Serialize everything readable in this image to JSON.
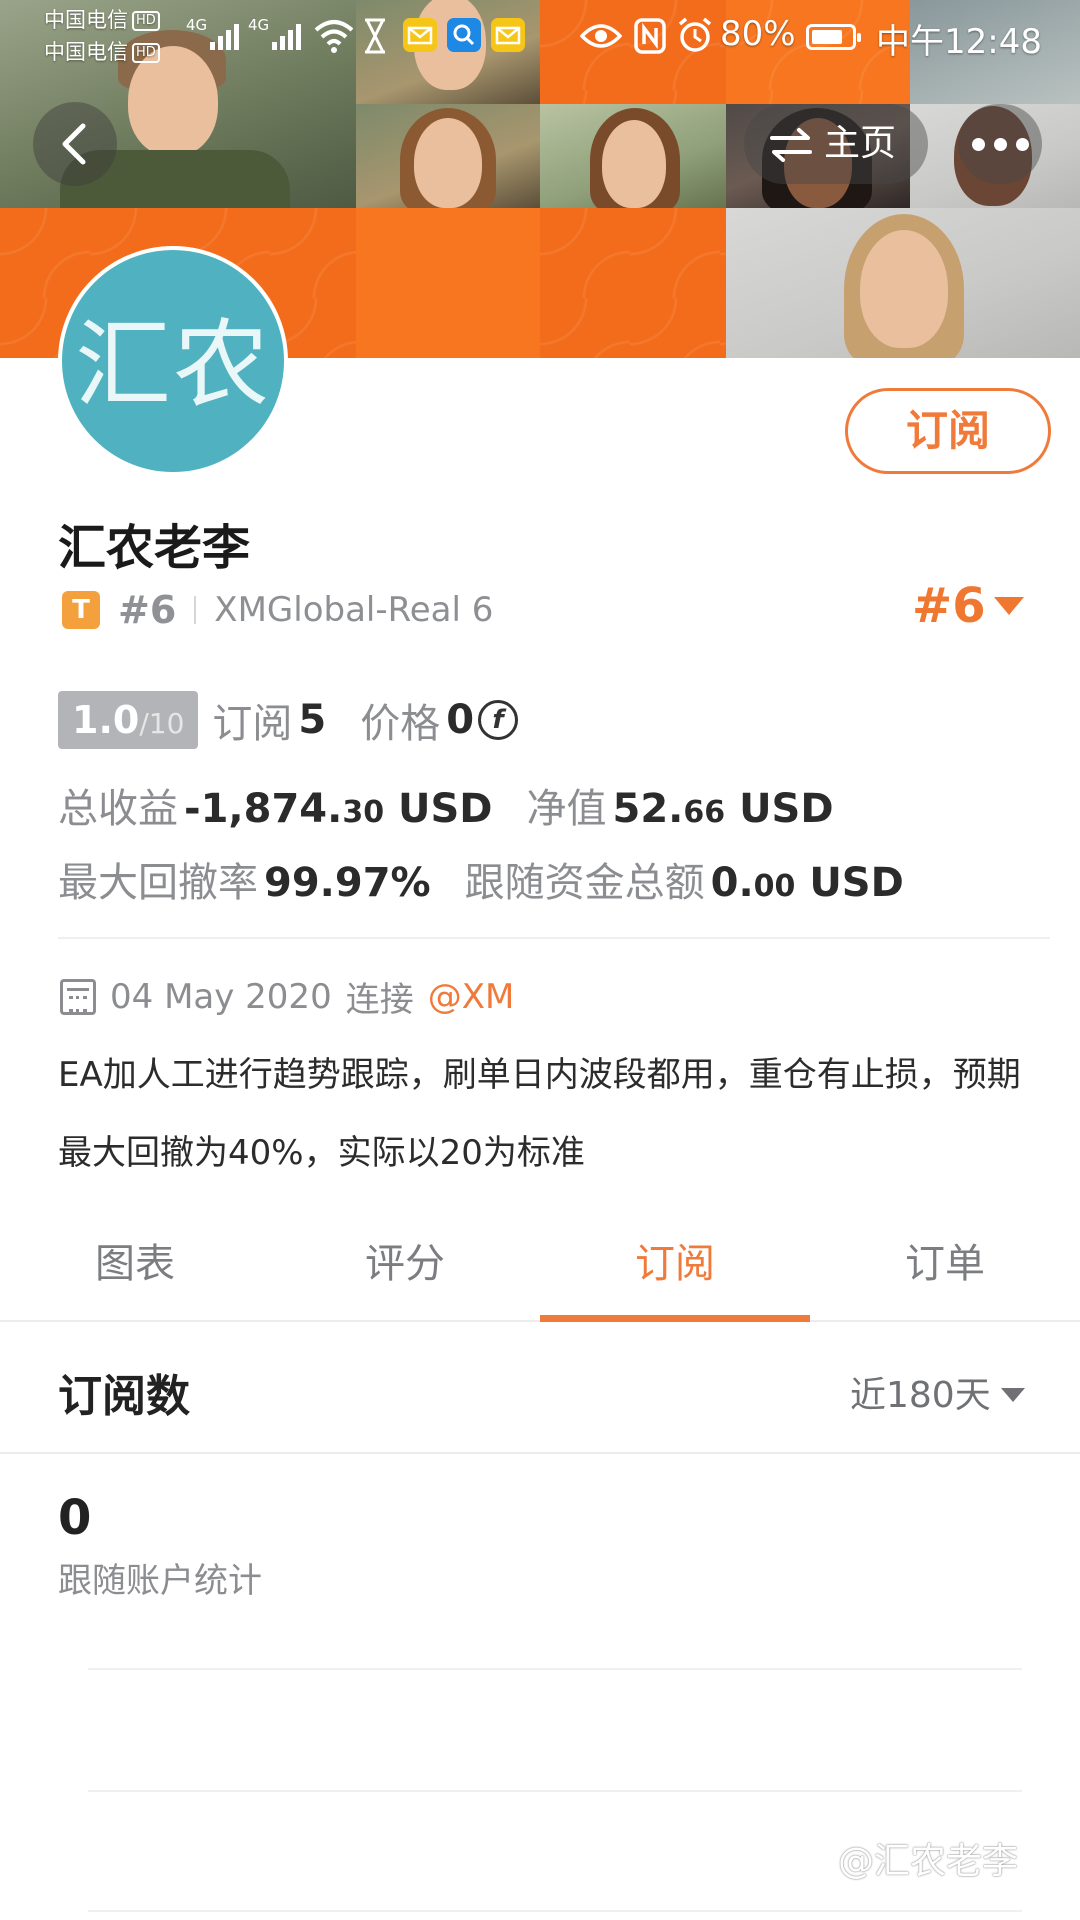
{
  "status_bar": {
    "carrier_1": "中国电信",
    "carrier_2": "中国电信",
    "hd": "HD",
    "network_1": "4G",
    "network_2": "4G",
    "battery": "80%",
    "time": "中午12:48"
  },
  "nav": {
    "home_label": "主页"
  },
  "profile": {
    "avatar_text": "汇农",
    "name": "汇农老李",
    "badge": "T",
    "rank": "#6",
    "server": "XMGlobal-Real 6",
    "rank_right": "#6",
    "subscribe_label": "订阅"
  },
  "stats": {
    "score": "1.0",
    "score_max": "/10",
    "subscriptions_label": "订阅",
    "subscriptions_value": "5",
    "price_label": "价格",
    "price_value": "0",
    "price_coin": "f",
    "total_profit_label": "总收益",
    "total_profit_main": "-1,874.",
    "total_profit_cents": "30",
    "total_profit_unit": "USD",
    "equity_label": "净值",
    "equity_main": "52.",
    "equity_cents": "66",
    "equity_unit": "USD",
    "max_drawdown_label": "最大回撤率",
    "max_drawdown_value": "99.97%",
    "follow_funds_label": "跟随资金总额",
    "follow_funds_main": "0.",
    "follow_funds_cents": "00",
    "follow_funds_unit": "USD"
  },
  "info": {
    "join_date": "04 May 2020",
    "join_connect": "连接",
    "broker": "@XM",
    "description": "EA加人工进行趋势跟踪，刷单日内波段都用，重仓有止损，预期最大回撤为40%，实际以20为标准"
  },
  "tabs": [
    {
      "label": "图表"
    },
    {
      "label": "评分"
    },
    {
      "label": "订阅"
    },
    {
      "label": "订单"
    }
  ],
  "active_tab": "订阅",
  "subscription_section": {
    "title": "订阅数",
    "period": "近180天",
    "count": "0",
    "count_label": "跟随账户统计"
  },
  "watermark": "@汇农老李",
  "colors": {
    "accent": "#f07a3a",
    "avatar_bg": "#50b2c0",
    "banner_orange": "#f36c1b",
    "badge_orange": "#f4a03c"
  }
}
